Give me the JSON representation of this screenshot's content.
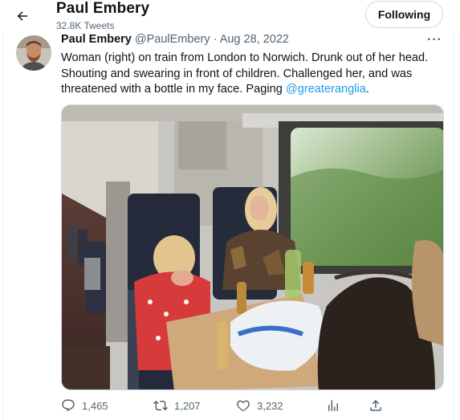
{
  "header": {
    "name": "Paul Embery",
    "tweet_count": "32.8K Tweets",
    "follow_label": "Following",
    "icons": {
      "back": "arrow-left-icon"
    }
  },
  "tweet": {
    "author_name": "Paul Embery",
    "handle": "@PaulEmbery",
    "separator": "·",
    "date": "Aug 28, 2022",
    "more": "···",
    "text": "Woman (right) on train from London to Norwich. Drunk out of her head. Shouting and swearing in front of children. Challenged her, and was threatened with a bottle in my face. Paging ",
    "mention": "@greateranglia",
    "text_end": ".",
    "media_alt": "Train carriage interior with passengers seated at a table"
  },
  "actions": {
    "replies": "1,465",
    "retweets": "1,207",
    "likes": "3,232",
    "icons": [
      "reply-icon",
      "retweet-icon",
      "like-icon",
      "analytics-icon",
      "share-icon"
    ]
  },
  "colors": {
    "text": "#0f1419",
    "secondary": "#536471",
    "link": "#1d9bf0",
    "border": "#cfd9de"
  }
}
